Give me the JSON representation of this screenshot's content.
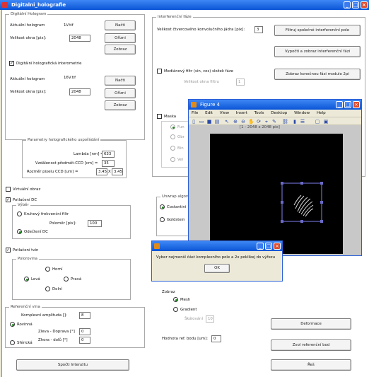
{
  "window": {
    "title": "Digitalni_holografie"
  },
  "left": {
    "panel_title": "Digitální Hologram",
    "h1": {
      "label": "Aktuální hologram",
      "value": "1V.tif",
      "load": "Načti",
      "size_label": "Velikost okna [pix]:",
      "size": "2048",
      "crop": "Ořízni",
      "show": "Zobraz"
    },
    "interferometry_label": "Digitální holografická interometrie",
    "interferometry_checked": "✓",
    "h2": {
      "label": "Aktuální hologram",
      "value": "16V.tif",
      "load": "Načti",
      "size_label": "Velikost okna [pix]:",
      "size": "2048",
      "crop": "Ořízni",
      "show": "Zobraz"
    },
    "params": {
      "title": "Parametry holografického uspořádání",
      "lambda_label": "Lambda [nm] =",
      "lambda": "633",
      "dist_label": "Vzdálenost předmět-CCD [cm] =",
      "dist": "35",
      "pixel_label": "Rozměr pixelu CCD [um] =",
      "pixel_x": "3.45",
      "x": "X",
      "pixel_y": "3.45"
    },
    "virtual_label": "Virtuální obraz",
    "dc_label": "Potlačení DC",
    "dc_checked": "✓",
    "dc_choice_title": "Výběr",
    "dc_opt1": "Kruhový frekvenční filtr",
    "radius_label": "Poloměr [pix]:",
    "radius": "100",
    "dc_opt2": "Odečtení DC",
    "twin_label": "Potlačení tvin",
    "twin_checked": "✓",
    "half_title": "Polorovina",
    "top": "Horní",
    "left": "Levá",
    "right": "Pravá",
    "bottom": "Dolní",
    "ref": {
      "title": "Referenční vlna",
      "amp_label": "Komplexní amplituda []:",
      "amp": "8",
      "plane": "Rovinná",
      "lr_label": "Zleva - Doprava [°]",
      "lr": "0",
      "tb_label": "Zhora - dolů [°]",
      "tb": "0",
      "sphere": "Sférická"
    },
    "compute": "Spočti Intenzitu"
  },
  "right": {
    "panel_title": "Interferenční fáze",
    "kernel_label": "Velikost čtvercového konvolučního jádra [pix]:",
    "kernel": "3",
    "filter_btn": "Filtruj společné interferenční pole",
    "compute_btn": "Vypočti a zobraz interferenční fázi",
    "median_label": "Mediánový filtr (sin, cos) složek fáze",
    "window_label": "Velikost okna filtru",
    "window": "1",
    "mod2pi_btn": "Zobraz konečnou fázi modulo 2pi",
    "mask_label": "Maska",
    "mask_partial_1": "Fun",
    "mask_partial_2": "Obr",
    "mask_partial_3": "Bin",
    "mask_partial_4": "Vel",
    "unwrap_title": "Unwrap algoritm",
    "costantini": "Costantini",
    "goldstein": "Goldstein",
    "show_label": "Zobraz",
    "mesh": "Mesh",
    "gradient": "Gradient",
    "scale_label": "Škálování",
    "scale": "10",
    "deform_btn": "Deformace",
    "refpoint_label": "Hodnota ref. bodu [um]:",
    "refpoint": "0",
    "choose_ref_btn": "Zvol referenční bod",
    "solve_btn": "Řeš"
  },
  "figure": {
    "title": "Figure 4",
    "menu": [
      "File",
      "Edit",
      "View",
      "Insert",
      "Tools",
      "Desktop",
      "Window",
      "Help"
    ],
    "axes_caption": "[1 - 2048 x 2048 pix]"
  },
  "dialog": {
    "message": "Vyber nejmenší část komplexního pole a 2x poklikej do výřezu",
    "ok": "OK"
  }
}
